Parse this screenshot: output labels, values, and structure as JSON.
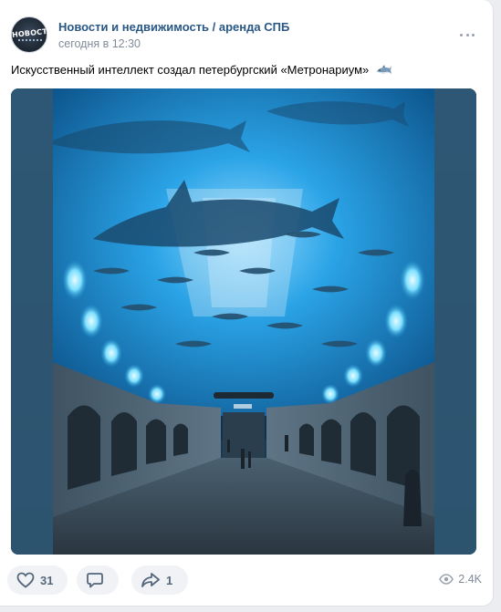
{
  "post": {
    "group_name": "Новости и недвижимость / аренда СПБ",
    "time": "сегодня в 12:30",
    "avatar_text": "НОВОСТИ",
    "text": "Искусственный интеллект создал петербургский «Метронариум»",
    "text_emoji": "shark-icon",
    "photo_description": "metro station with aquarium ceiling and sharks"
  },
  "actions": {
    "likes": "31",
    "comments": "",
    "shares": "1",
    "views": "2.4K"
  },
  "colors": {
    "link": "#2a5885",
    "secondary_text": "#818c99",
    "action_bg": "#f0f2f5",
    "action_icon": "#55677d"
  }
}
